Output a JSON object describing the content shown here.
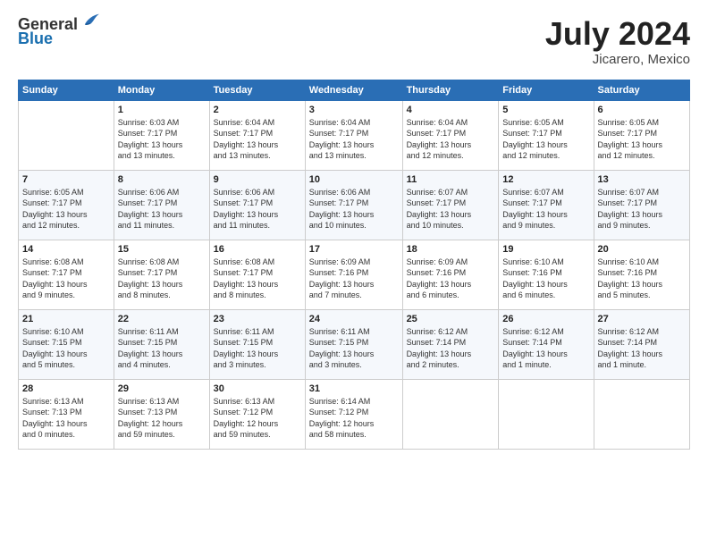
{
  "header": {
    "logo_line1": "General",
    "logo_line2": "Blue",
    "month": "July 2024",
    "location": "Jicarero, Mexico"
  },
  "days_of_week": [
    "Sunday",
    "Monday",
    "Tuesday",
    "Wednesday",
    "Thursday",
    "Friday",
    "Saturday"
  ],
  "weeks": [
    [
      {
        "day": "",
        "info": ""
      },
      {
        "day": "1",
        "info": "Sunrise: 6:03 AM\nSunset: 7:17 PM\nDaylight: 13 hours\nand 13 minutes."
      },
      {
        "day": "2",
        "info": "Sunrise: 6:04 AM\nSunset: 7:17 PM\nDaylight: 13 hours\nand 13 minutes."
      },
      {
        "day": "3",
        "info": "Sunrise: 6:04 AM\nSunset: 7:17 PM\nDaylight: 13 hours\nand 13 minutes."
      },
      {
        "day": "4",
        "info": "Sunrise: 6:04 AM\nSunset: 7:17 PM\nDaylight: 13 hours\nand 12 minutes."
      },
      {
        "day": "5",
        "info": "Sunrise: 6:05 AM\nSunset: 7:17 PM\nDaylight: 13 hours\nand 12 minutes."
      },
      {
        "day": "6",
        "info": "Sunrise: 6:05 AM\nSunset: 7:17 PM\nDaylight: 13 hours\nand 12 minutes."
      }
    ],
    [
      {
        "day": "7",
        "info": ""
      },
      {
        "day": "8",
        "info": "Sunrise: 6:06 AM\nSunset: 7:17 PM\nDaylight: 13 hours\nand 11 minutes."
      },
      {
        "day": "9",
        "info": "Sunrise: 6:06 AM\nSunset: 7:17 PM\nDaylight: 13 hours\nand 11 minutes."
      },
      {
        "day": "10",
        "info": "Sunrise: 6:06 AM\nSunset: 7:17 PM\nDaylight: 13 hours\nand 10 minutes."
      },
      {
        "day": "11",
        "info": "Sunrise: 6:07 AM\nSunset: 7:17 PM\nDaylight: 13 hours\nand 10 minutes."
      },
      {
        "day": "12",
        "info": "Sunrise: 6:07 AM\nSunset: 7:17 PM\nDaylight: 13 hours\nand 9 minutes."
      },
      {
        "day": "13",
        "info": "Sunrise: 6:07 AM\nSunset: 7:17 PM\nDaylight: 13 hours\nand 9 minutes."
      }
    ],
    [
      {
        "day": "14",
        "info": ""
      },
      {
        "day": "15",
        "info": "Sunrise: 6:08 AM\nSunset: 7:17 PM\nDaylight: 13 hours\nand 8 minutes."
      },
      {
        "day": "16",
        "info": "Sunrise: 6:08 AM\nSunset: 7:17 PM\nDaylight: 13 hours\nand 8 minutes."
      },
      {
        "day": "17",
        "info": "Sunrise: 6:09 AM\nSunset: 7:16 PM\nDaylight: 13 hours\nand 7 minutes."
      },
      {
        "day": "18",
        "info": "Sunrise: 6:09 AM\nSunset: 7:16 PM\nDaylight: 13 hours\nand 6 minutes."
      },
      {
        "day": "19",
        "info": "Sunrise: 6:10 AM\nSunset: 7:16 PM\nDaylight: 13 hours\nand 6 minutes."
      },
      {
        "day": "20",
        "info": "Sunrise: 6:10 AM\nSunset: 7:16 PM\nDaylight: 13 hours\nand 5 minutes."
      }
    ],
    [
      {
        "day": "21",
        "info": ""
      },
      {
        "day": "22",
        "info": "Sunrise: 6:11 AM\nSunset: 7:15 PM\nDaylight: 13 hours\nand 4 minutes."
      },
      {
        "day": "23",
        "info": "Sunrise: 6:11 AM\nSunset: 7:15 PM\nDaylight: 13 hours\nand 3 minutes."
      },
      {
        "day": "24",
        "info": "Sunrise: 6:11 AM\nSunset: 7:15 PM\nDaylight: 13 hours\nand 3 minutes."
      },
      {
        "day": "25",
        "info": "Sunrise: 6:12 AM\nSunset: 7:14 PM\nDaylight: 13 hours\nand 2 minutes."
      },
      {
        "day": "26",
        "info": "Sunrise: 6:12 AM\nSunset: 7:14 PM\nDaylight: 13 hours\nand 1 minute."
      },
      {
        "day": "27",
        "info": "Sunrise: 6:12 AM\nSunset: 7:14 PM\nDaylight: 13 hours\nand 1 minute."
      }
    ],
    [
      {
        "day": "28",
        "info": "Sunrise: 6:13 AM\nSunset: 7:13 PM\nDaylight: 13 hours\nand 0 minutes."
      },
      {
        "day": "29",
        "info": "Sunrise: 6:13 AM\nSunset: 7:13 PM\nDaylight: 12 hours\nand 59 minutes."
      },
      {
        "day": "30",
        "info": "Sunrise: 6:13 AM\nSunset: 7:12 PM\nDaylight: 12 hours\nand 59 minutes."
      },
      {
        "day": "31",
        "info": "Sunrise: 6:14 AM\nSunset: 7:12 PM\nDaylight: 12 hours\nand 58 minutes."
      },
      {
        "day": "",
        "info": ""
      },
      {
        "day": "",
        "info": ""
      },
      {
        "day": "",
        "info": ""
      }
    ]
  ],
  "week7_sunday": "Sunrise: 6:05 AM\nSunset: 7:17 PM\nDaylight: 13 hours\nand 12 minutes.",
  "week14_sunday": "Sunrise: 6:08 AM\nSunset: 7:17 PM\nDaylight: 13 hours\nand 9 minutes.",
  "week21_sunday": "Sunrise: 6:10 AM\nSunset: 7:15 PM\nDaylight: 13 hours\nand 5 minutes."
}
